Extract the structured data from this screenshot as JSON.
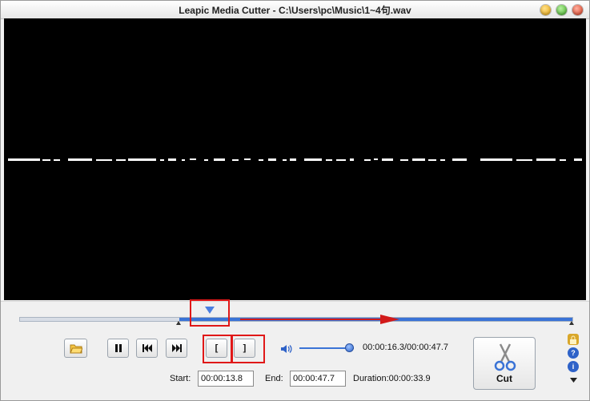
{
  "window": {
    "title": "Leapic Media Cutter - C:\\Users\\pc\\Music\\1~4句.wav"
  },
  "playback": {
    "time_display": "00:00:16.3/00:00:47.7",
    "position_fraction": 0.345,
    "selection_start_fraction": 0.289,
    "selection_end_fraction": 1.0,
    "volume_fraction": 0.92
  },
  "toolbar": {
    "open_icon": "folder-open-icon",
    "pause_icon": "pause-icon",
    "prev_icon": "skip-back-icon",
    "next_icon": "skip-forward-icon",
    "mark_in_label": "[",
    "mark_out_label": "]",
    "volume_icon": "speaker-icon",
    "cut_label": "Cut"
  },
  "fields": {
    "start_label": "Start:",
    "start_value": "00:00:13.8",
    "end_label": "End:",
    "end_value": "00:00:47.7",
    "duration_text": "Duration:00:00:33.9"
  },
  "side_icons": [
    "lock-icon",
    "help-icon",
    "info-icon",
    "arrow-down-icon"
  ],
  "colors": {
    "accent": "#3a73d6",
    "highlight": "#e01818"
  }
}
